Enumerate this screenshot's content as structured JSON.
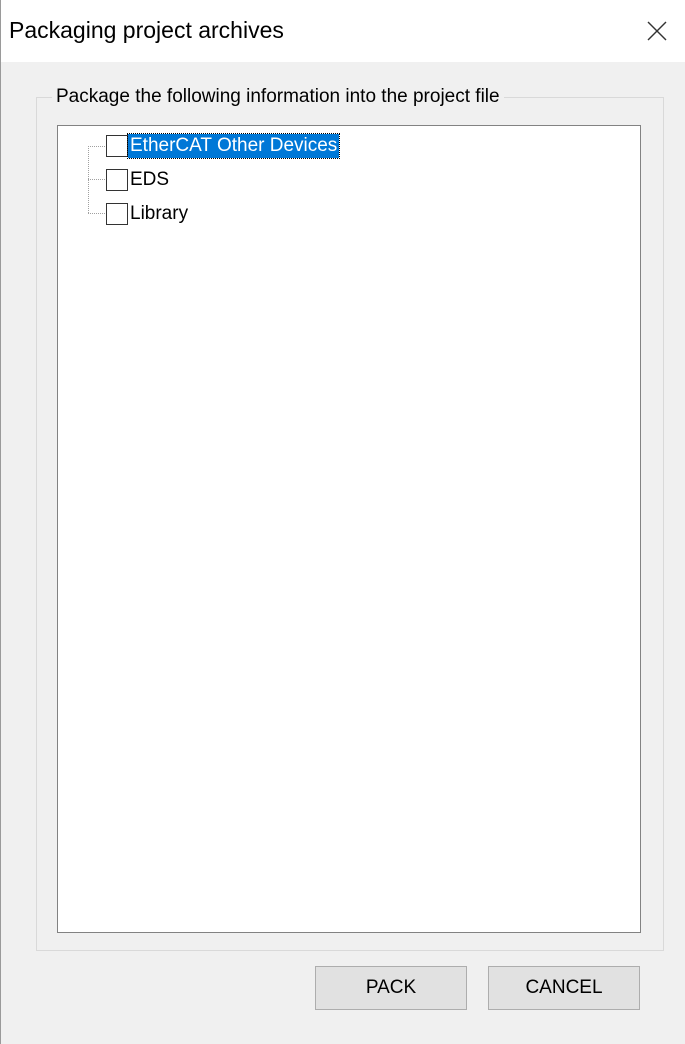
{
  "window": {
    "title": "Packaging project archives",
    "close_icon": "close-icon"
  },
  "group": {
    "label": "Package the following information into the project file"
  },
  "tree": {
    "items": [
      {
        "label": "EtherCAT Other Devices",
        "checked": false,
        "selected": true
      },
      {
        "label": "EDS",
        "checked": false,
        "selected": false
      },
      {
        "label": "Library",
        "checked": false,
        "selected": false
      }
    ]
  },
  "buttons": {
    "pack": "PACK",
    "cancel": "CANCEL"
  },
  "colors": {
    "selection": "#0078d7",
    "dialog_bg": "#f0f0f0",
    "button_bg": "#e1e1e1"
  }
}
